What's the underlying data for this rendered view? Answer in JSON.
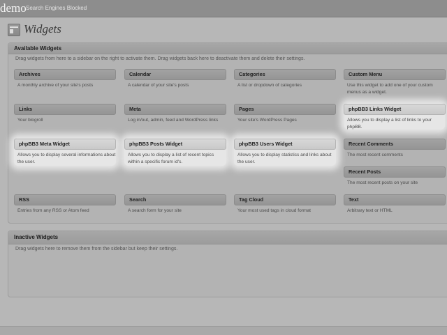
{
  "topbar": {
    "site_name": "demo",
    "status": "Search Engines Blocked"
  },
  "page": {
    "title": "Widgets",
    "icon": "widgets-icon"
  },
  "available": {
    "heading": "Available Widgets",
    "description": "Drag widgets from here to a sidebar on the right to activate them. Drag widgets back here to deactivate them and delete their settings.",
    "widgets": [
      {
        "title": "Archives",
        "desc": "A monthly archive of your site's posts"
      },
      {
        "title": "Calendar",
        "desc": "A calendar of your site's posts"
      },
      {
        "title": "Categories",
        "desc": "A list or dropdown of categories"
      },
      {
        "title": "Custom Menu",
        "desc": "Use this widget to add one of your custom menus as a widget."
      },
      {
        "title": "Links",
        "desc": "Your blogroll"
      },
      {
        "title": "Meta",
        "desc": "Log in/out, admin, feed and WordPress links"
      },
      {
        "title": "Pages",
        "desc": "Your site's WordPress Pages"
      },
      {
        "title": "phpBB3 Links Widget",
        "desc": "Allows you to display a list of links to your phpBB."
      },
      {
        "title": "phpBB3 Meta Widget",
        "desc": "Allows you to display several informations about the user."
      },
      {
        "title": "phpBB3 Posts Widget",
        "desc": "Allows you to display a list of recent topics within a specific forum id's."
      },
      {
        "title": "phpBB3 Users Widget",
        "desc": "Allows you to display statistics and links about the user."
      },
      {
        "title": "Recent Comments",
        "desc": "The most recent comments"
      },
      {
        "title": "Recent Posts",
        "desc": "The most recent posts on your site"
      },
      {
        "title": "RSS",
        "desc": "Entries from any RSS or Atom feed"
      },
      {
        "title": "Search",
        "desc": "A search form for your site"
      },
      {
        "title": "Tag Cloud",
        "desc": "Your most used tags in cloud format"
      },
      {
        "title": "Text",
        "desc": "Arbitrary text or HTML"
      }
    ]
  },
  "inactive": {
    "heading": "Inactive Widgets",
    "description": "Drag widgets here to remove them from the sidebar but keep their settings."
  }
}
